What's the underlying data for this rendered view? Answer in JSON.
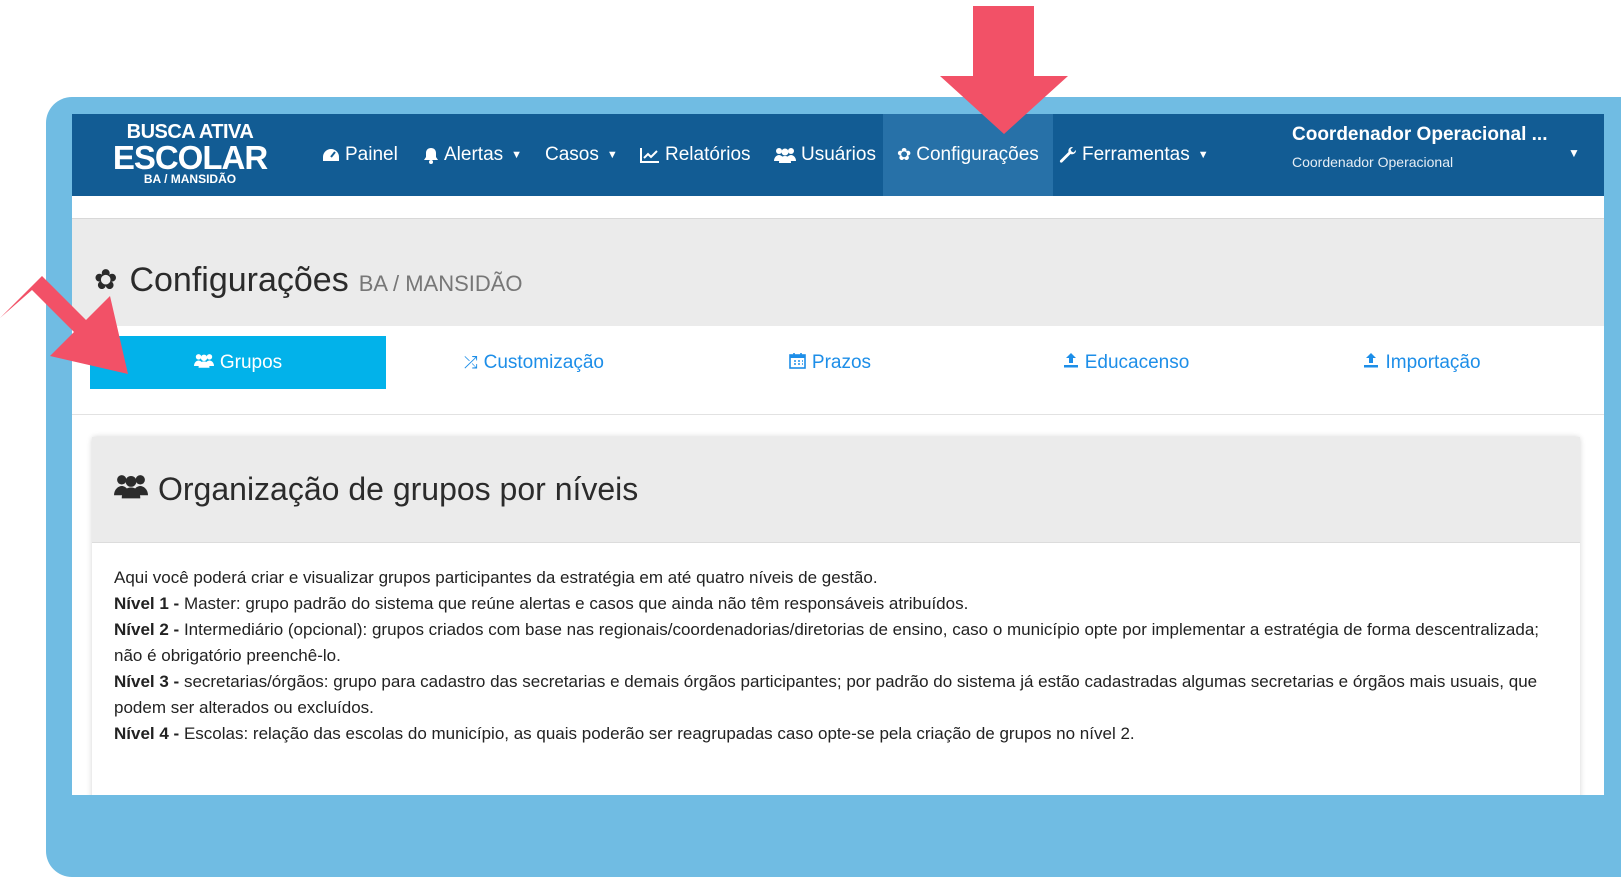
{
  "brand": {
    "line1": "BUSCA ATIVA",
    "line2": "ESCOLAR",
    "line3": "BA / MANSIDÃO"
  },
  "nav": {
    "items": [
      {
        "label": "Painel",
        "icon": "dashboard-icon",
        "dropdown": false,
        "active": false
      },
      {
        "label": "Alertas",
        "icon": "bell-icon",
        "dropdown": true,
        "active": false
      },
      {
        "label": "Casos",
        "icon": "",
        "dropdown": true,
        "active": false
      },
      {
        "label": "Relatórios",
        "icon": "line-chart-icon",
        "dropdown": false,
        "active": false
      },
      {
        "label": "Usuários",
        "icon": "users-icon",
        "dropdown": false,
        "active": false
      },
      {
        "label": "Configurações",
        "icon": "gear-icon",
        "dropdown": false,
        "active": true
      },
      {
        "label": "Ferramentas",
        "icon": "wrench-icon",
        "dropdown": true,
        "active": false
      }
    ],
    "user": {
      "name": "Coordenador Operacional ...",
      "role": "Coordenador Operacional"
    }
  },
  "page": {
    "title": "Configurações",
    "location": "BA / MANSIDÃO"
  },
  "tabs": [
    {
      "label": "Grupos",
      "icon": "users-icon",
      "active": true
    },
    {
      "label": "Customização",
      "icon": "shuffle-icon",
      "active": false
    },
    {
      "label": "Prazos",
      "icon": "calendar-icon",
      "active": false
    },
    {
      "label": "Educacenso",
      "icon": "upload-icon",
      "active": false
    },
    {
      "label": "Importação",
      "icon": "upload-icon",
      "active": false
    }
  ],
  "panel": {
    "title": "Organização de grupos por níveis",
    "intro": "Aqui você poderá criar e visualizar grupos participantes da estratégia em até quatro níveis de gestão.",
    "levels": [
      {
        "label": "Nível 1 -",
        "text": "Master: grupo padrão do sistema que reúne alertas e casos que ainda não têm responsáveis atribuídos."
      },
      {
        "label": "Nível 2 -",
        "text": "Intermediário (opcional): grupos criados com base nas regionais/coordenadorias/diretorias de ensino, caso o município opte por implementar a estratégia de forma descentralizada; não é obrigatório preenchê-lo."
      },
      {
        "label": "Nível 3 -",
        "text": "secretarias/órgãos: grupo para cadastro das secretarias e demais órgãos participantes; por padrão do sistema já estão cadastradas algumas secretarias e órgãos mais usuais, que podem ser alterados ou excluídos."
      },
      {
        "label": "Nível 4 -",
        "text": "Escolas: relação das escolas do município, as quais poderão ser reagrupadas caso opte-se pela criação de grupos no nível 2."
      }
    ]
  },
  "colors": {
    "navbar": "#125c94",
    "frame": "#70bce3",
    "tab_active": "#02b2ea",
    "link": "#1d8ee8",
    "arrow": "#f25167"
  }
}
